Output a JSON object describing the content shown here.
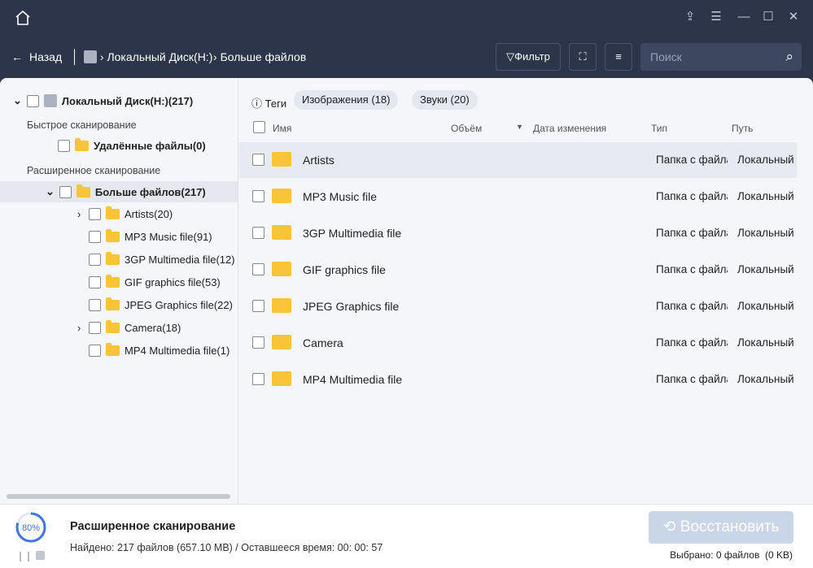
{
  "nav": {
    "back": "Назад",
    "crumb1": "Локальный Диск(H:)",
    "crumb2": "Больше файлов",
    "filter": "Фильтр",
    "search_placeholder": "Поиск"
  },
  "sidebar": {
    "root": "Локальный Диск(H:)(217)",
    "quick_scan": "Быстрое сканирование",
    "deleted": "Удалённые файлы(0)",
    "deep_scan": "Расширенное сканирование",
    "more": "Больше файлов(217)",
    "items": [
      {
        "label": "Artists(20)",
        "expandable": true
      },
      {
        "label": "MP3 Music file(91)",
        "expandable": false
      },
      {
        "label": "3GP Multimedia file(12)",
        "expandable": false
      },
      {
        "label": "GIF graphics file(53)",
        "expandable": false
      },
      {
        "label": "JPEG Graphics file(22)",
        "expandable": false
      },
      {
        "label": "Camera(18)",
        "expandable": true
      },
      {
        "label": "MP4 Multimedia file(1)",
        "expandable": false
      }
    ]
  },
  "main": {
    "tags": "Теги",
    "chip_images": "Изображения (18)",
    "chip_sounds": "Звуки (20)",
    "columns": {
      "name": "Имя",
      "size": "Объём",
      "date": "Дата изменения",
      "type": "Тип",
      "path": "Путь"
    },
    "rows": [
      {
        "name": "Artists",
        "type": "Папка с файлами",
        "path": "Локальный Диск"
      },
      {
        "name": "MP3 Music file",
        "type": "Папка с файлами",
        "path": "Локальный Диск"
      },
      {
        "name": "3GP Multimedia file",
        "type": "Папка с файлами",
        "path": "Локальный Диск"
      },
      {
        "name": "GIF graphics file",
        "type": "Папка с файлами",
        "path": "Локальный Диск"
      },
      {
        "name": "JPEG Graphics file",
        "type": "Папка с файлами",
        "path": "Локальный Диск"
      },
      {
        "name": "Camera",
        "type": "Папка с файлами",
        "path": "Локальный Диск"
      },
      {
        "name": "MP4 Multimedia file",
        "type": "Папка с файлами",
        "path": "Локальный Диск"
      }
    ]
  },
  "footer": {
    "progress_label": "80%",
    "progress": 0.8,
    "title": "Расширенное сканирование",
    "status": "Найдено: 217 файлов (657.10 MB) / Оставшееся время: 00: 00: 57",
    "recover": "Восстановить",
    "selected": "Выбрано: 0 файлов  (0 KB)"
  }
}
